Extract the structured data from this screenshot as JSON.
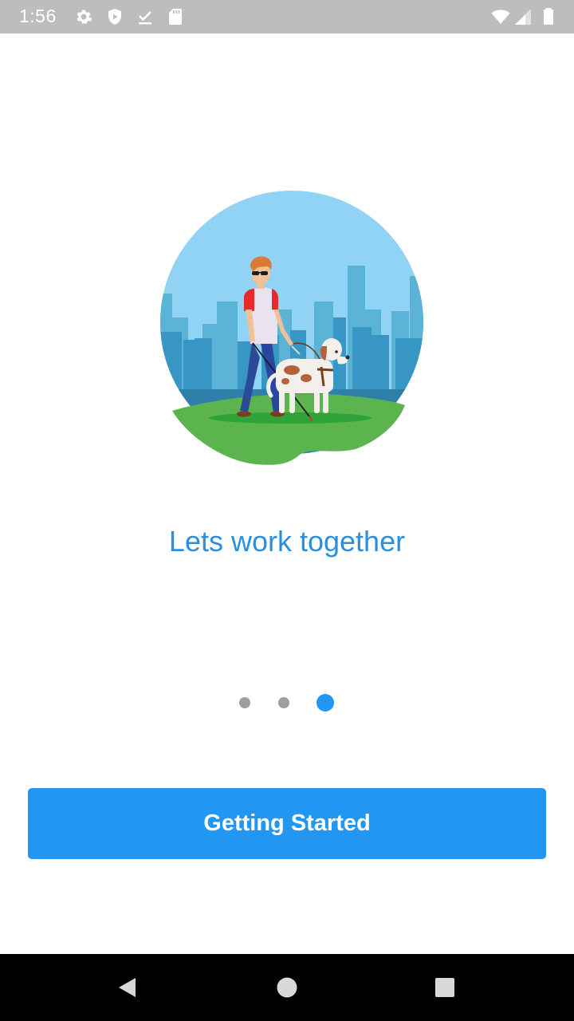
{
  "status_bar": {
    "time": "1:56",
    "left_icons": [
      "settings-icon",
      "shield-icon",
      "download-done-icon",
      "sd-card-icon"
    ],
    "right_icons": [
      "wifi-icon",
      "cell-signal-icon",
      "battery-icon"
    ]
  },
  "onboarding": {
    "illustration": "person-with-guide-dog-illustration",
    "tagline": "Lets work together",
    "pager": {
      "total": 3,
      "active_index": 2
    },
    "cta_label": "Getting Started"
  },
  "colors": {
    "accent": "#2196f3",
    "tagline": "#2a8fdc",
    "inactive_dot": "#9e9e9e",
    "status_bar": "#bdbdbd"
  },
  "nav_bar": {
    "buttons": [
      "back-icon",
      "home-icon",
      "recents-icon"
    ]
  }
}
